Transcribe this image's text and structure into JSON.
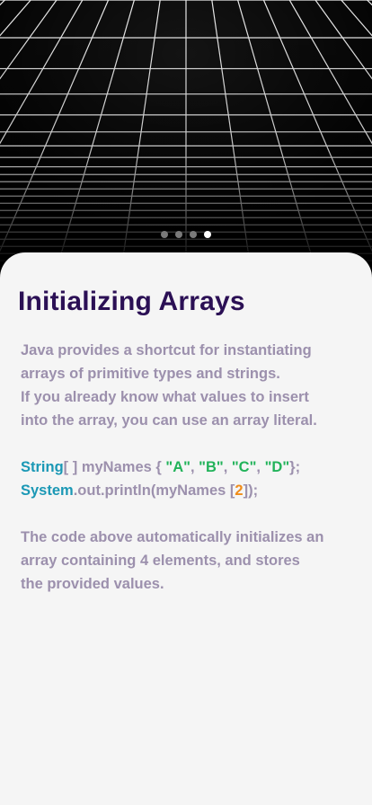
{
  "pager": {
    "total": 4,
    "active_index": 3
  },
  "lesson": {
    "title": "Initializing Arrays",
    "intro_line1": "Java provides a shortcut for instantiating arrays of primitive types and strings.",
    "intro_line2": "If you already know what values to insert into the array, you can use an array literal.",
    "code": {
      "line1": {
        "type_kw": "String",
        "brackets": "[ ]",
        "decl": " myNames { ",
        "s1": "\"A\"",
        "sep1": ", ",
        "s2": "\"B\"",
        "sep2": ", ",
        "s3": "\"C\"",
        "sep3": ", ",
        "s4": "\"D\"",
        "end": "};"
      },
      "line2": {
        "class_kw": "System",
        "call": ".out.println(myNames [",
        "index": "2",
        "end": "]);"
      }
    },
    "outro": "The code above automatically initializes an array containing 4 elements, and stores the provided values."
  },
  "colors": {
    "title": "#2b1055",
    "body_text": "#9c90ad",
    "keyword": "#1b98b5",
    "string": "#22b35a",
    "number": "#f08c1a",
    "card_bg": "#f5f5f5",
    "dot_inactive": "#7a7a7a",
    "dot_active": "#ffffff"
  }
}
